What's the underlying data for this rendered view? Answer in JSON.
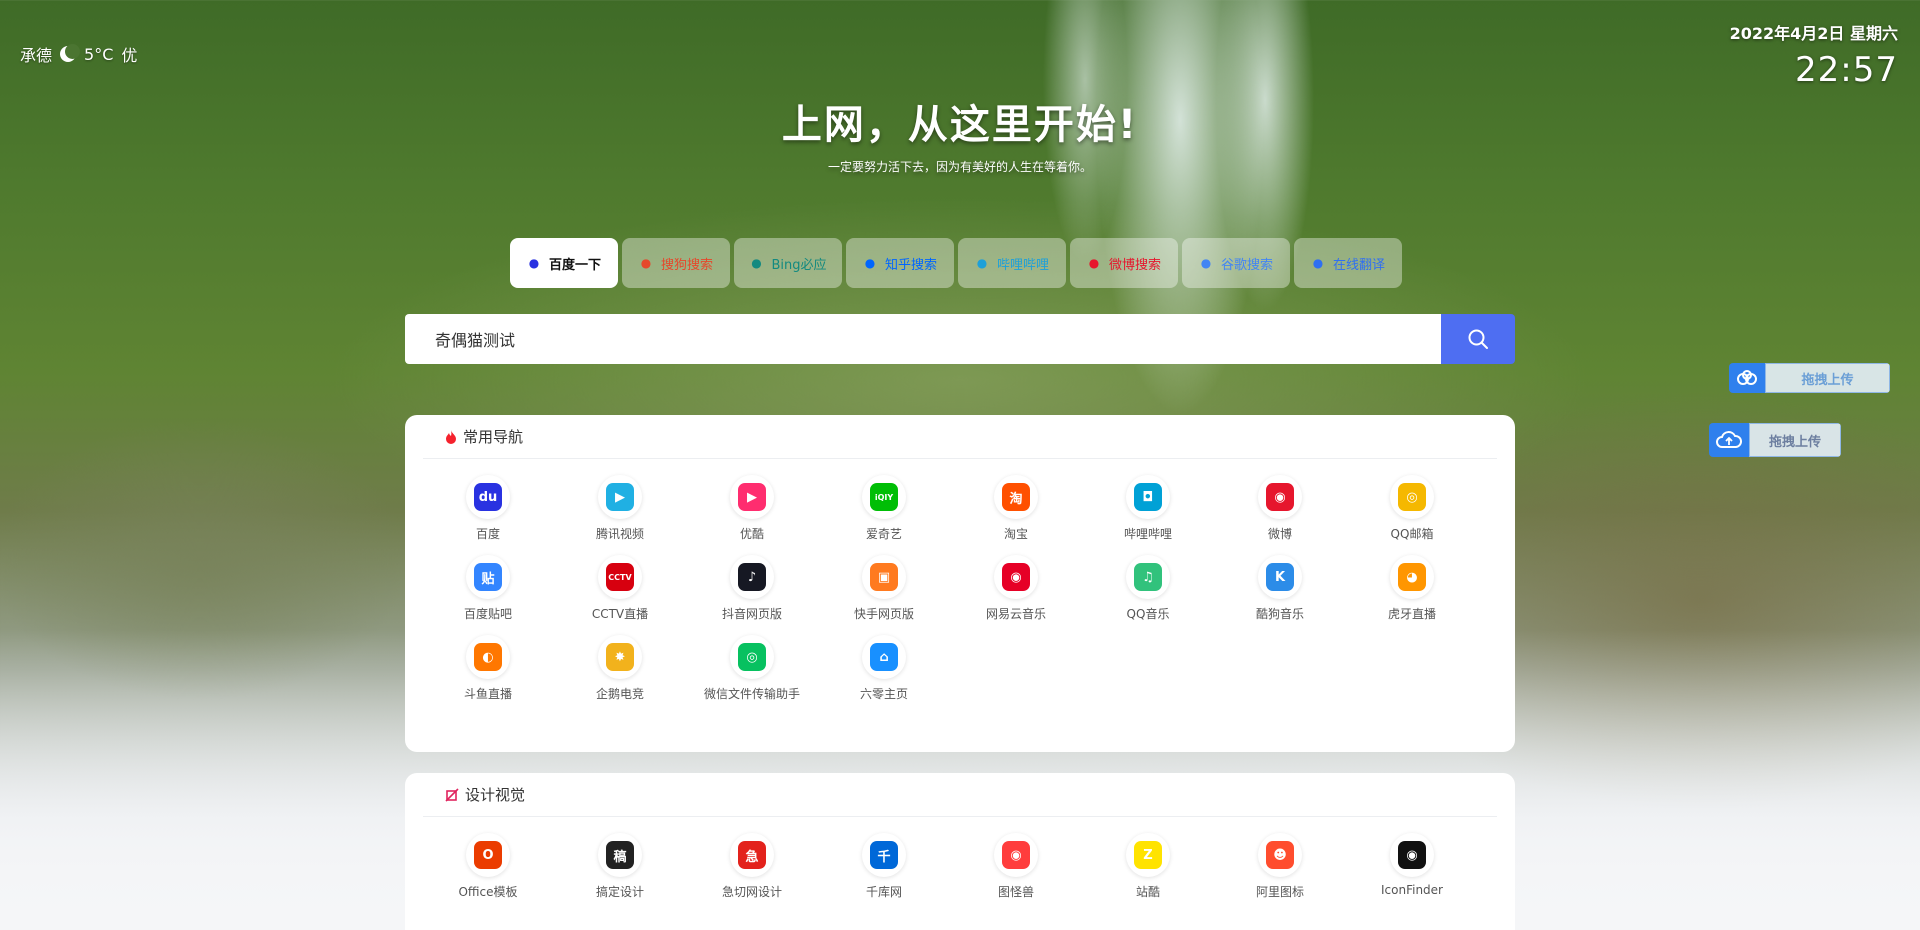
{
  "weather": {
    "city": "承德",
    "temp": "5°C",
    "quality": "优"
  },
  "clock": {
    "date": "2022年4月2日 星期六",
    "time": "22:57"
  },
  "hero": {
    "title": "上网，从这里开始!",
    "subtitle": "一定要努力活下去，因为有美好的人生在等着你。"
  },
  "search_tabs": [
    {
      "label": "百度一下",
      "icon": "baidu-paw-icon",
      "color": "#2932e1",
      "active": true
    },
    {
      "label": "搜狗搜索",
      "icon": "sogou-icon",
      "color": "#e6482b"
    },
    {
      "label": "Bing必应",
      "icon": "bing-icon",
      "color": "#138a80"
    },
    {
      "label": "知乎搜索",
      "icon": "zhihu-icon",
      "color": "#0066ff"
    },
    {
      "label": "哔哩哔哩",
      "icon": "bilibili-icon",
      "color": "#1ea0d9"
    },
    {
      "label": "微博搜索",
      "icon": "weibo-icon",
      "color": "#e6162d"
    },
    {
      "label": "谷歌搜索",
      "icon": "google-icon",
      "color": "#4285f4"
    },
    {
      "label": "在线翻译",
      "icon": "translate-icon",
      "color": "#2f6ff2"
    }
  ],
  "search": {
    "value": "奇偶猫测试",
    "button_icon": "search-icon",
    "button_color": "#4e6ef2"
  },
  "uploads": [
    {
      "label": "拖拽上传",
      "icon": "baidu-netdisk-icon"
    },
    {
      "label": "拖拽上传",
      "icon": "cloud-upload-icon"
    }
  ],
  "sections": [
    {
      "title": "常用导航",
      "icon": "fire-icon",
      "items": [
        {
          "label": "百度",
          "icon": "baidu-icon",
          "glyph": "du",
          "color": "#2932e1"
        },
        {
          "label": "腾讯视频",
          "icon": "tencent-video-icon",
          "glyph": "▶",
          "color": "#20b0e3"
        },
        {
          "label": "优酷",
          "icon": "youku-icon",
          "glyph": "▶",
          "color": "#ff2d6f"
        },
        {
          "label": "爱奇艺",
          "icon": "iqiyi-icon",
          "glyph": "iQIY",
          "color": "#00be06"
        },
        {
          "label": "淘宝",
          "icon": "taobao-icon",
          "glyph": "淘",
          "color": "#ff5000"
        },
        {
          "label": "哔哩哔哩",
          "icon": "bilibili-icon",
          "glyph": "◘",
          "color": "#00a1d6"
        },
        {
          "label": "微博",
          "icon": "weibo-icon",
          "glyph": "◉",
          "color": "#e6162d"
        },
        {
          "label": "QQ邮箱",
          "icon": "qq-mail-icon",
          "glyph": "◎",
          "color": "#f5b800"
        },
        {
          "label": "百度贴吧",
          "icon": "tieba-icon",
          "glyph": "贴",
          "color": "#3385ff"
        },
        {
          "label": "CCTV直播",
          "icon": "cctv-icon",
          "glyph": "CCTV",
          "color": "#d7000f"
        },
        {
          "label": "抖音网页版",
          "icon": "douyin-icon",
          "glyph": "♪",
          "color": "#161823"
        },
        {
          "label": "快手网页版",
          "icon": "kuaishou-icon",
          "glyph": "▣",
          "color": "#ff7a1f"
        },
        {
          "label": "网易云音乐",
          "icon": "netease-music-icon",
          "glyph": "◉",
          "color": "#e60026"
        },
        {
          "label": "QQ音乐",
          "icon": "qq-music-icon",
          "glyph": "♫",
          "color": "#31c27c"
        },
        {
          "label": "酷狗音乐",
          "icon": "kugou-icon",
          "glyph": "K",
          "color": "#2c8ce8"
        },
        {
          "label": "虎牙直播",
          "icon": "huya-icon",
          "glyph": "◕",
          "color": "#ff9600"
        },
        {
          "label": "斗鱼直播",
          "icon": "douyu-icon",
          "glyph": "◐",
          "color": "#ff7700"
        },
        {
          "label": "企鹅电竞",
          "icon": "penguin-esports-icon",
          "glyph": "✸",
          "color": "#f2b21c"
        },
        {
          "label": "微信文件传输助手",
          "icon": "wechat-icon",
          "glyph": "◎",
          "color": "#07c160"
        },
        {
          "label": "六零主页",
          "icon": "home-icon",
          "glyph": "⌂",
          "color": "#1890ff"
        }
      ]
    },
    {
      "title": "设计视觉",
      "icon": "design-icon",
      "items": [
        {
          "label": "Office模板",
          "icon": "office-icon",
          "glyph": "O",
          "color": "#eb3c00"
        },
        {
          "label": "搞定设计",
          "icon": "gaoding-icon",
          "glyph": "稿",
          "color": "#222222"
        },
        {
          "label": "急切网设计",
          "icon": "jiqie-icon",
          "glyph": "急",
          "color": "#e3221c"
        },
        {
          "label": "千库网",
          "icon": "qianku-icon",
          "glyph": "千",
          "color": "#0068d8"
        },
        {
          "label": "图怪兽",
          "icon": "tuguaishou-icon",
          "glyph": "◉",
          "color": "#ff3d3d"
        },
        {
          "label": "站酷",
          "icon": "zcool-icon",
          "glyph": "Z",
          "color": "#ffe300"
        },
        {
          "label": "阿里图标",
          "icon": "iconfont-icon",
          "glyph": "☻",
          "color": "#ff4d2e"
        },
        {
          "label": "IconFinder",
          "icon": "iconfinder-icon",
          "glyph": "◉",
          "color": "#111111"
        }
      ]
    }
  ]
}
